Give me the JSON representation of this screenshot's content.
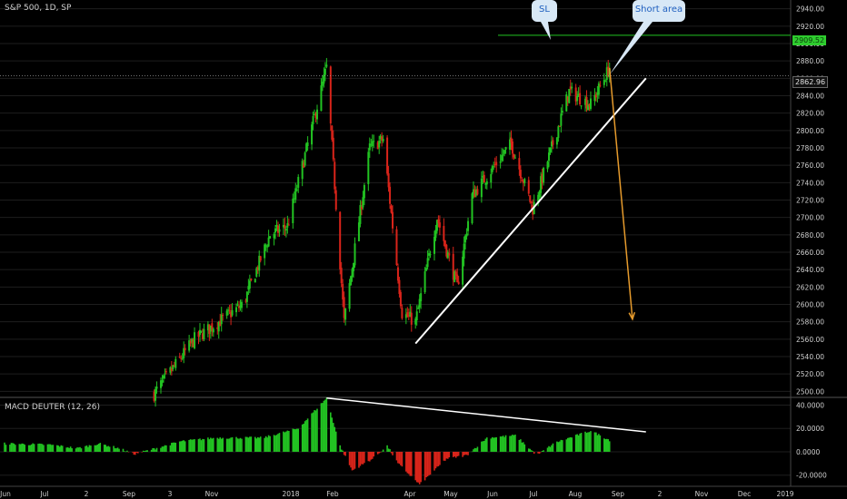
{
  "title": "S&P 500, 1D, SP",
  "macd_title": "MACD DEUTER (12, 26)",
  "callouts": {
    "sl": "SL",
    "short": "Short area"
  },
  "price_tags": {
    "sl_level": "2909.52",
    "last_price": "2862.96"
  },
  "colors": {
    "up": "#22c322",
    "down": "#d9241a",
    "trend": "#ffffff",
    "projection": "#e59a2c",
    "sl_line": "#22c322",
    "grid": "#1e1e1e"
  },
  "chart_data": [
    {
      "type": "candlestick",
      "title": "S&P 500, 1D, SP",
      "x_ticks": [
        "Jun",
        "Jul",
        "2",
        "Sep",
        "3",
        "Nov",
        "2018",
        "Feb",
        "Apr",
        "May",
        "Jun",
        "Jul",
        "Aug",
        "Sep",
        "2",
        "Nov",
        "Dec",
        "2019"
      ],
      "y_ticks": [
        2500,
        2520,
        2540,
        2560,
        2580,
        2600,
        2620,
        2640,
        2660,
        2680,
        2700,
        2720,
        2740,
        2760,
        2780,
        2800,
        2820,
        2840,
        2860,
        2880,
        2900,
        2920,
        2940
      ],
      "ylim": [
        2492,
        2948
      ],
      "anchors": [
        {
          "date": "2017-09-20",
          "close": 2497
        },
        {
          "date": "2017-10-20",
          "close": 2560
        },
        {
          "date": "2017-11-25",
          "close": 2600
        },
        {
          "date": "2017-12-15",
          "close": 2680
        },
        {
          "date": "2017-12-28",
          "close": 2690
        },
        {
          "date": "2018-01-26",
          "close": 2872
        },
        {
          "date": "2018-02-08",
          "close": 2580
        },
        {
          "date": "2018-02-27",
          "close": 2780
        },
        {
          "date": "2018-03-09",
          "close": 2790
        },
        {
          "date": "2018-03-23",
          "close": 2590
        },
        {
          "date": "2018-04-02",
          "close": 2580
        },
        {
          "date": "2018-04-18",
          "close": 2700
        },
        {
          "date": "2018-05-03",
          "close": 2620
        },
        {
          "date": "2018-05-14",
          "close": 2725
        },
        {
          "date": "2018-06-12",
          "close": 2785
        },
        {
          "date": "2018-06-28",
          "close": 2710
        },
        {
          "date": "2018-07-25",
          "close": 2845
        },
        {
          "date": "2018-08-10",
          "close": 2830
        },
        {
          "date": "2018-08-24",
          "close": 2872
        }
      ],
      "sl_level": 2909.52,
      "last_price": 2862.96,
      "trendline": [
        {
          "date": "2018-04-02",
          "value": 2555
        },
        {
          "date": "2018-09-20",
          "value": 2860
        }
      ],
      "projection": [
        {
          "date": "2018-08-24",
          "value": 2872
        },
        {
          "date": "2018-09-10",
          "value": 2583
        }
      ]
    },
    {
      "type": "bar",
      "title": "MACD DEUTER (12, 26)",
      "y_ticks": [
        -20,
        0,
        20,
        40
      ],
      "ylim": [
        -28,
        45
      ],
      "anchors": [
        {
          "date": "2017-06-01",
          "value": 7
        },
        {
          "date": "2017-07-05",
          "value": 6
        },
        {
          "date": "2017-07-25",
          "value": 3
        },
        {
          "date": "2017-08-10",
          "value": 7
        },
        {
          "date": "2017-08-25",
          "value": 3
        },
        {
          "date": "2017-09-05",
          "value": -2
        },
        {
          "date": "2017-09-15",
          "value": 1
        },
        {
          "date": "2017-10-10",
          "value": 9
        },
        {
          "date": "2017-11-05",
          "value": 12
        },
        {
          "date": "2017-12-10",
          "value": 12
        },
        {
          "date": "2018-01-05",
          "value": 20
        },
        {
          "date": "2018-01-26",
          "value": 46
        },
        {
          "date": "2018-02-05",
          "value": 5
        },
        {
          "date": "2018-02-14",
          "value": -16
        },
        {
          "date": "2018-03-01",
          "value": -6
        },
        {
          "date": "2018-03-12",
          "value": 5
        },
        {
          "date": "2018-03-20",
          "value": -10
        },
        {
          "date": "2018-04-05",
          "value": -28
        },
        {
          "date": "2018-04-25",
          "value": -6
        },
        {
          "date": "2018-05-10",
          "value": -3
        },
        {
          "date": "2018-05-25",
          "value": 12
        },
        {
          "date": "2018-06-15",
          "value": 14
        },
        {
          "date": "2018-07-01",
          "value": -3
        },
        {
          "date": "2018-07-15",
          "value": 8
        },
        {
          "date": "2018-08-10",
          "value": 18
        },
        {
          "date": "2018-08-24",
          "value": 10
        }
      ],
      "trendline": [
        {
          "date": "2018-01-26",
          "value": 46
        },
        {
          "date": "2018-09-20",
          "value": 17
        }
      ]
    }
  ]
}
